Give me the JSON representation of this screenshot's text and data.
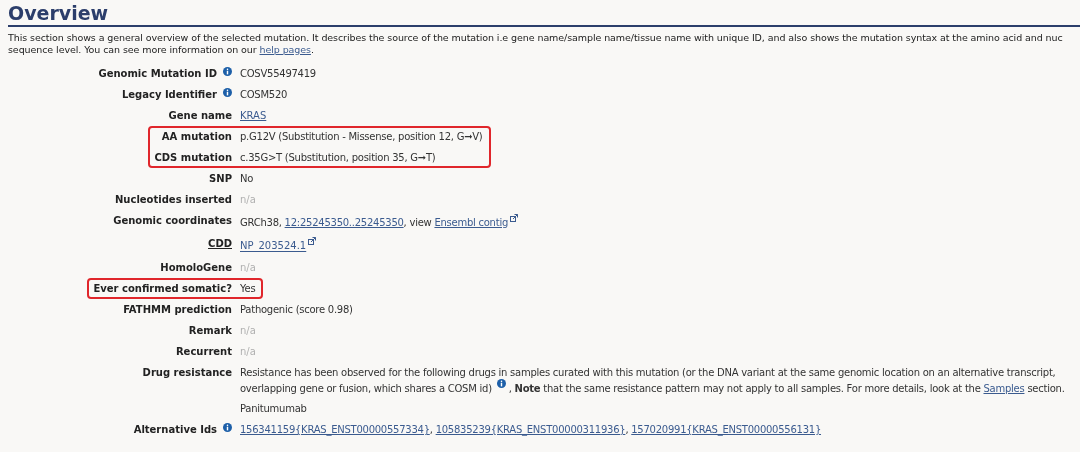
{
  "section": {
    "title": "Overview",
    "intro_lines": [
      [
        {
          "kind": "text",
          "text": "This section shows a general overview of the selected mutation. It describes the source of the mutation i.e gene name/sample name/tissue name with unique ID, and also shows the mutation syntax at the amino acid and nuc"
        }
      ],
      [
        {
          "kind": "text",
          "text": "sequence level. You can see more information on our "
        },
        {
          "kind": "link",
          "text": "help pages"
        },
        {
          "kind": "text",
          "text": "."
        }
      ]
    ]
  },
  "rows": [
    {
      "label": "Genomic Mutation ID",
      "info": true,
      "label_link": false,
      "highlighted": false,
      "lines": [
        [
          {
            "kind": "text",
            "text": "COSV55497419"
          }
        ]
      ]
    },
    {
      "label": "Legacy Identifier",
      "info": true,
      "label_link": false,
      "highlighted": false,
      "lines": [
        [
          {
            "kind": "text",
            "text": "COSM520"
          }
        ]
      ]
    },
    {
      "label": "Gene name",
      "info": false,
      "label_link": false,
      "highlighted": false,
      "lines": [
        [
          {
            "kind": "link",
            "text": "KRAS"
          }
        ]
      ]
    },
    {
      "label": "AA mutation",
      "info": false,
      "label_link": false,
      "highlighted": true,
      "lines": [
        [
          {
            "kind": "text",
            "text": "p.G12V (Substitution - Missense, position 12, G➞V)"
          }
        ]
      ]
    },
    {
      "label": "CDS mutation",
      "info": false,
      "label_link": false,
      "highlighted": true,
      "lines": [
        [
          {
            "kind": "text",
            "text": "c.35G>T (Substitution, position 35, G➞T)"
          }
        ]
      ]
    },
    {
      "label": "SNP",
      "info": false,
      "label_link": false,
      "highlighted": false,
      "lines": [
        [
          {
            "kind": "text",
            "text": "No"
          }
        ]
      ]
    },
    {
      "label": "Nucleotides inserted",
      "info": false,
      "label_link": false,
      "highlighted": false,
      "lines": [
        [
          {
            "kind": "muted",
            "text": "n/a"
          }
        ]
      ]
    },
    {
      "label": "Genomic coordinates",
      "info": false,
      "label_link": false,
      "highlighted": false,
      "lines": [
        [
          {
            "kind": "text",
            "text": "GRCh38, "
          },
          {
            "kind": "link",
            "text": "12:25245350..25245350"
          },
          {
            "kind": "text",
            "text": ", view "
          },
          {
            "kind": "link",
            "text": "Ensembl contig"
          },
          {
            "kind": "external"
          }
        ]
      ]
    },
    {
      "label": "CDD",
      "info": false,
      "label_link": true,
      "highlighted": false,
      "lines": [
        [
          {
            "kind": "link",
            "text": "NP_203524.1"
          },
          {
            "kind": "external"
          }
        ]
      ]
    },
    {
      "label": "HomoloGene",
      "info": false,
      "label_link": false,
      "highlighted": false,
      "lines": [
        [
          {
            "kind": "muted",
            "text": "n/a"
          }
        ]
      ]
    },
    {
      "label": "Ever confirmed somatic?",
      "info": false,
      "label_link": false,
      "highlighted": true,
      "lines": [
        [
          {
            "kind": "text",
            "text": "Yes"
          }
        ]
      ]
    },
    {
      "label": "FATHMM prediction",
      "info": false,
      "label_link": false,
      "highlighted": false,
      "lines": [
        [
          {
            "kind": "text",
            "text": "Pathogenic (score 0.98)"
          }
        ]
      ]
    },
    {
      "label": "Remark",
      "info": false,
      "label_link": false,
      "highlighted": false,
      "lines": [
        [
          {
            "kind": "muted",
            "text": "n/a"
          }
        ]
      ]
    },
    {
      "label": "Recurrent",
      "info": false,
      "label_link": false,
      "highlighted": false,
      "lines": [
        [
          {
            "kind": "muted",
            "text": "n/a"
          }
        ]
      ]
    },
    {
      "label": "Drug resistance",
      "info": false,
      "label_link": false,
      "highlighted": false,
      "lines": [
        [
          {
            "kind": "text",
            "text": "Resistance has been observed for the following drugs in samples curated with this mutation (or the DNA variant at the same genomic location on an alternative transcript, overlapping gene or fusion, which shares a COSM id) "
          },
          {
            "kind": "info"
          },
          {
            "kind": "text",
            "text": " , **Note** that the same resistance pattern may not apply to all samples. For more details, look at the "
          },
          {
            "kind": "link",
            "text": "Samples"
          },
          {
            "kind": "text",
            "text": " section."
          }
        ],
        [
          {
            "kind": "text",
            "text": "Panitumumab"
          }
        ]
      ]
    },
    {
      "label": "Alternative Ids",
      "info": true,
      "label_link": false,
      "highlighted": false,
      "lines": [
        [
          {
            "kind": "link",
            "text": "156341159{KRAS_ENST00000557334}"
          },
          {
            "kind": "text",
            "text": ", "
          },
          {
            "kind": "link",
            "text": "105835239{KRAS_ENST00000311936}"
          },
          {
            "kind": "text",
            "text": ", "
          },
          {
            "kind": "link",
            "text": "157020991{KRAS_ENST00000556131}"
          }
        ]
      ]
    }
  ]
}
